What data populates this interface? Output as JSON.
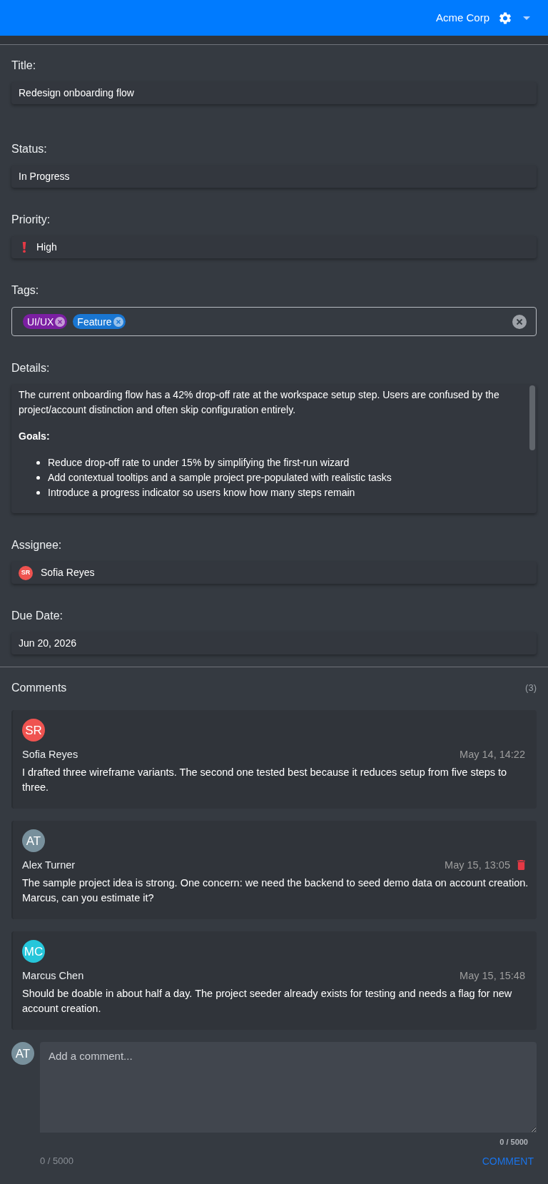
{
  "header": {
    "org_name": "Acme Corp"
  },
  "fields": [
    {
      "kind": "text",
      "label": "Title:",
      "value": "Redesign onboarding flow"
    },
    {
      "kind": "text",
      "label": "Status:",
      "value": "In Progress"
    },
    {
      "kind": "priority",
      "label": "Priority:",
      "value": "High"
    },
    {
      "kind": "tags",
      "label": "Tags:",
      "tags": [
        {
          "label": "UI/UX",
          "color": "#7b1fa2"
        },
        {
          "label": "Feature",
          "color": "#1976d2"
        }
      ]
    },
    {
      "kind": "rich_text",
      "label": "Details:",
      "paragraph": "The current onboarding flow has a 42% drop-off rate at the workspace setup step. Users are confused by the project/account distinction and often skip configuration entirely.",
      "heading": "Goals:",
      "bullets": [
        "Reduce drop-off rate to under 15% by simplifying the first-run wizard",
        "Add contextual tooltips and a sample project pre-populated with realistic tasks",
        "Introduce a progress indicator so users know how many steps remain"
      ]
    },
    {
      "kind": "person",
      "label": "Assignee:",
      "initials": "SR",
      "color": "#ef5350",
      "value": "Sofia Reyes"
    },
    {
      "kind": "text",
      "label": "Due Date:",
      "value": "Jun 20, 2026"
    }
  ],
  "comments": {
    "title": "Comments",
    "count": "(3)",
    "items": [
      {
        "initials": "SR",
        "color": "#ef5350",
        "author": "Sofia Reyes",
        "time": "May 14, 14:22",
        "deletable": false,
        "text": "I drafted three wireframe variants. The second one tested best because it reduces setup from five steps to three."
      },
      {
        "initials": "AT",
        "color": "#78909c",
        "author": "Alex Turner",
        "time": "May 15, 13:05",
        "deletable": true,
        "text": "The sample project idea is strong. One concern: we need the backend to seed demo data on account creation. Marcus, can you estimate it?"
      },
      {
        "initials": "MC",
        "color": "#26c6da",
        "author": "Marcus Chen",
        "time": "May 15, 15:48",
        "deletable": false,
        "text": "Should be doable in about half a day. The project seeder already exists for testing and needs a flag for new account creation."
      }
    ]
  },
  "composer": {
    "initials": "AT",
    "color": "#78909c",
    "placeholder": "Add a comment...",
    "counter": "0 / 5000",
    "footer_counter": "0 / 5000",
    "button": "COMMENT"
  }
}
